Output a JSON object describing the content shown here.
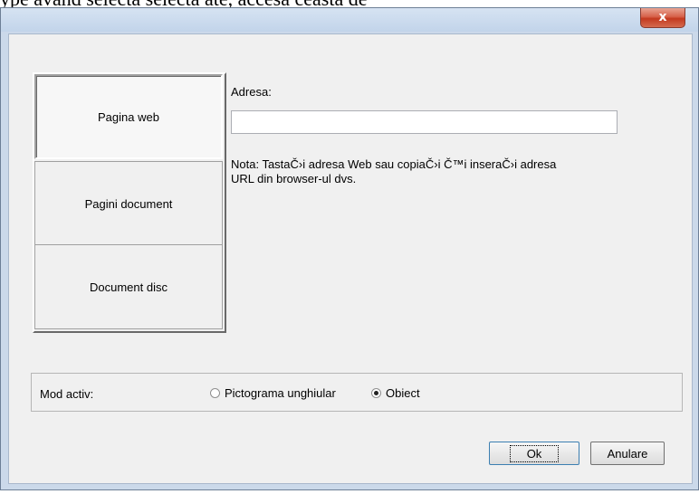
{
  "background_text": "ype     avand selecta  selecta    ate, accesa   ceasta de",
  "window": {
    "close_glyph": "x",
    "colors": {
      "frame": "#cbd9ea",
      "client": "#f0f0f0",
      "close": "#c3391f"
    }
  },
  "tabs": [
    {
      "label": "Pagina web",
      "active": true
    },
    {
      "label": "Pagini document",
      "active": false
    },
    {
      "label": "Document disc",
      "active": false
    }
  ],
  "address": {
    "label": "Adresa:",
    "value": "",
    "note_line1": "Nota: TastaČ›i adresa Web sau copiaČ›i Č™i inseraČ›i adresa",
    "note_line2": "URL din browser-ul dvs."
  },
  "mode": {
    "label": "Mod activ:",
    "options": [
      {
        "label": "Pictograma unghiular",
        "checked": false
      },
      {
        "label": "Obiect",
        "checked": true
      }
    ]
  },
  "buttons": {
    "ok": "Ok",
    "cancel": "Anulare"
  }
}
